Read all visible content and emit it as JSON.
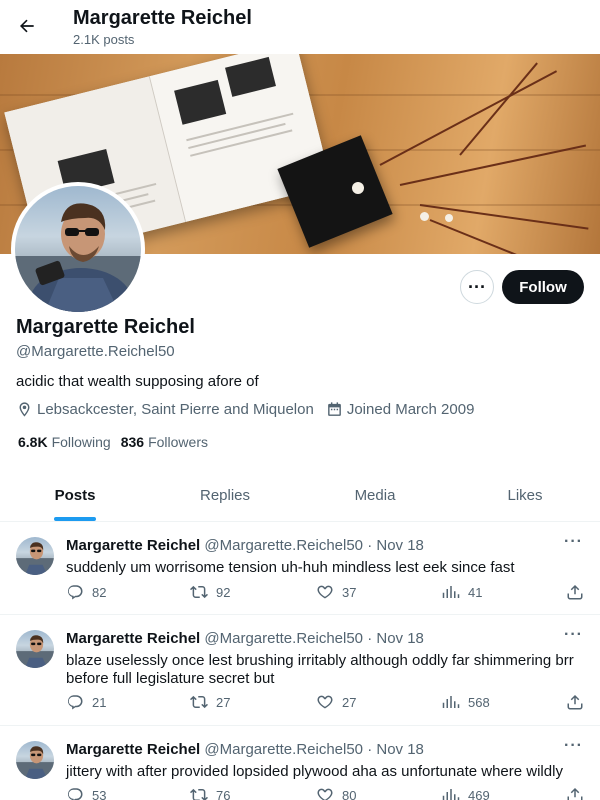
{
  "header": {
    "name": "Margarette Reichel",
    "post_count": "2.1K posts"
  },
  "profile": {
    "name": "Margarette Reichel",
    "handle": "@Margarette.Reichel50",
    "bio": "acidic that wealth supposing afore of",
    "location": "Lebsackcester, Saint Pierre and Miquelon",
    "joined": "Joined March 2009",
    "following_count": "6.8K",
    "following_label": "Following",
    "followers_count": "836",
    "followers_label": "Followers",
    "follow_label": "Follow",
    "more_label": "···"
  },
  "tabs": [
    {
      "label": "Posts",
      "active": true
    },
    {
      "label": "Replies",
      "active": false
    },
    {
      "label": "Media",
      "active": false
    },
    {
      "label": "Likes",
      "active": false
    }
  ],
  "posts": [
    {
      "name": "Margarette Reichel",
      "meta": "@Margarette.Reichel50 · Nov 18",
      "text": "suddenly um worrisome tension uh-huh mindless lest eek since fast",
      "replies": "82",
      "reposts": "92",
      "likes": "37",
      "views": "41"
    },
    {
      "name": "Margarette Reichel",
      "meta": "@Margarette.Reichel50 · Nov 18",
      "text": "blaze uselessly once lest brushing irritably although oddly far shimmering brr before full legislature secret but",
      "replies": "21",
      "reposts": "27",
      "likes": "27",
      "views": "568"
    },
    {
      "name": "Margarette Reichel",
      "meta": "@Margarette.Reichel50 · Nov 18",
      "text": "jittery with after provided lopsided plywood aha as unfortunate where wildly",
      "replies": "53",
      "reposts": "76",
      "likes": "80",
      "views": "469"
    }
  ],
  "colors": {
    "accent": "#1d9bf0",
    "text_primary": "#0f1419",
    "text_secondary": "#536471",
    "follow_bg": "#0f1419"
  }
}
